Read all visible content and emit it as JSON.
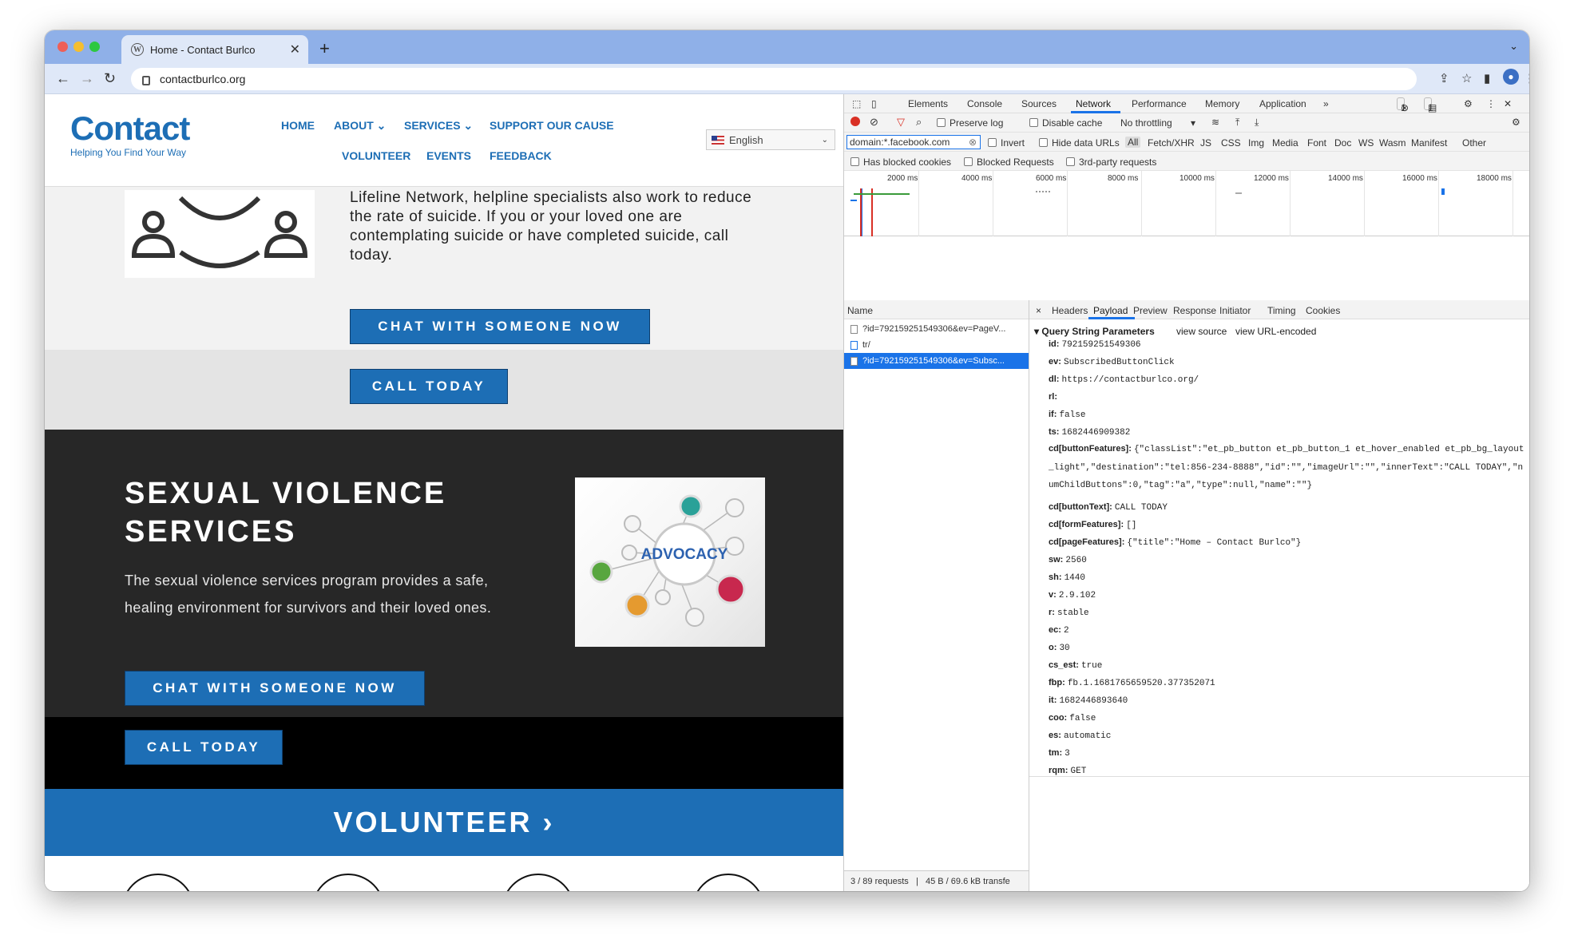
{
  "browser": {
    "tab_title": "Home - Contact Burlco",
    "url": "contactburlco.org",
    "new_tab": "+",
    "tab_close": "✕",
    "tab_menu": "⌄"
  },
  "site": {
    "logo_word": "Contact",
    "logo_tagline": "Helping You Find Your Way",
    "menu": {
      "home": "HOME",
      "about": "ABOUT ⌄",
      "services": "SERVICES ⌄",
      "support": "SUPPORT OUR CAUSE",
      "volunteer": "VOLUNTEER",
      "events": "EVENTS",
      "feedback": "FEEDBACK"
    },
    "language": "English",
    "section1_text": "Lifeline Network, helpline specialists also work to reduce the rate of suicide. If you or your loved one are contemplating suicide or have completed suicide, call today.",
    "chat_button": "CHAT WITH SOMEONE NOW",
    "call_button": "CALL TODAY",
    "section2_title_1": "SEXUAL VIOLENCE",
    "section2_title_2": "SERVICES",
    "section2_text": "The sexual violence services program provides a safe, healing environment for survivors and their loved ones.",
    "advocacy_label": "ADVOCACY",
    "volunteer_banner": "VOLUNTEER ›"
  },
  "devtools": {
    "tabs": [
      "Elements",
      "Console",
      "Sources",
      "Network",
      "Performance",
      "Memory",
      "Application"
    ],
    "more_tabs": "»",
    "errors_count": "1",
    "messages_count": "1",
    "toolbar": {
      "preserve_log": "Preserve log",
      "disable_cache": "Disable cache",
      "throttling": "No throttling"
    },
    "filter": {
      "value": "domain:*.facebook.com",
      "invert": "Invert",
      "hide_data_urls": "Hide data URLs",
      "types": [
        "All",
        "Fetch/XHR",
        "JS",
        "CSS",
        "Img",
        "Media",
        "Font",
        "Doc",
        "WS",
        "Wasm",
        "Manifest",
        "Other"
      ],
      "has_blocked_cookies": "Has blocked cookies",
      "blocked_requests": "Blocked Requests",
      "third_party": "3rd-party requests"
    },
    "timeline_ticks": [
      "2000 ms",
      "4000 ms",
      "6000 ms",
      "8000 ms",
      "10000 ms",
      "12000 ms",
      "14000 ms",
      "16000 ms",
      "18000 ms"
    ],
    "requests_header": "Name",
    "requests": [
      "?id=792159251549306&ev=PageV...",
      "tr/",
      "?id=792159251549306&ev=Subsc..."
    ],
    "footer": {
      "requests": "3 / 89 requests",
      "transferred": "45 B / 69.6 kB transfe"
    },
    "detail_tabs": [
      "Headers",
      "Payload",
      "Preview",
      "Response",
      "Initiator",
      "Timing",
      "Cookies"
    ],
    "detail_close": "×",
    "qs_header": "Query String Parameters",
    "view_source": "view source",
    "view_encoded": "view URL-encoded",
    "params": [
      {
        "k": "id:",
        "v": "792159251549306"
      },
      {
        "k": "ev:",
        "v": "SubscribedButtonClick"
      },
      {
        "k": "dl:",
        "v": "https://contactburlco.org/"
      },
      {
        "k": "rl:",
        "v": ""
      },
      {
        "k": "if:",
        "v": "false"
      },
      {
        "k": "ts:",
        "v": "1682446909382"
      },
      {
        "k": "cd[buttonFeatures]:",
        "v": "{\"classList\":\"et_pb_button et_pb_button_1 et_hover_enabled et_pb_bg_layout_light\",\"destination\":\"tel:856-234-8888\",\"id\":\"\",\"imageUrl\":\"\",\"innerText\":\"CALL TODAY\",\"numChildButtons\":0,\"tag\":\"a\",\"type\":null,\"name\":\"\"}"
      },
      {
        "k": "cd[buttonText]:",
        "v": "CALL TODAY"
      },
      {
        "k": "cd[formFeatures]:",
        "v": "[]"
      },
      {
        "k": "cd[pageFeatures]:",
        "v": "{\"title\":\"Home – Contact Burlco\"}"
      },
      {
        "k": "sw:",
        "v": "2560"
      },
      {
        "k": "sh:",
        "v": "1440"
      },
      {
        "k": "v:",
        "v": "2.9.102"
      },
      {
        "k": "r:",
        "v": "stable"
      },
      {
        "k": "ec:",
        "v": "2"
      },
      {
        "k": "o:",
        "v": "30"
      },
      {
        "k": "cs_est:",
        "v": "true"
      },
      {
        "k": "fbp:",
        "v": "fb.1.1681765659520.377352071"
      },
      {
        "k": "it:",
        "v": "1682446893640"
      },
      {
        "k": "coo:",
        "v": "false"
      },
      {
        "k": "es:",
        "v": "automatic"
      },
      {
        "k": "tm:",
        "v": "3"
      },
      {
        "k": "rqm:",
        "v": "GET"
      }
    ]
  }
}
